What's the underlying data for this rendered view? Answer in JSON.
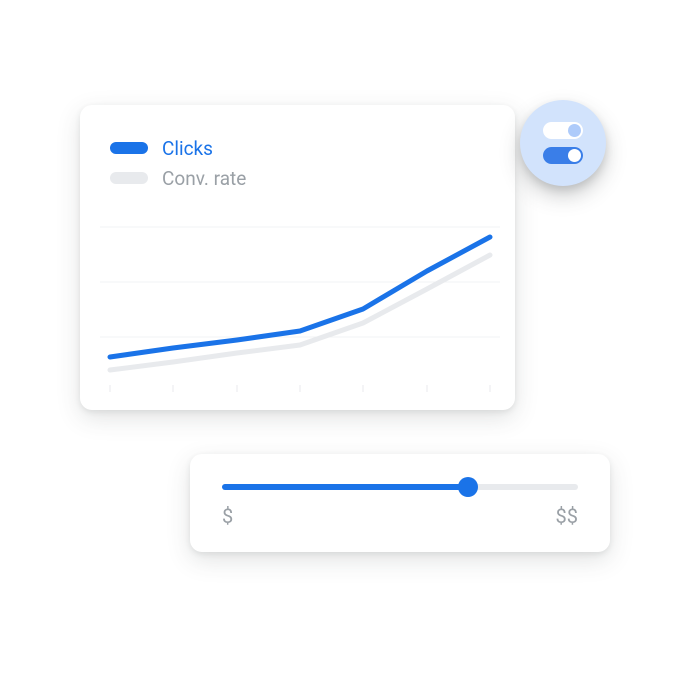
{
  "chart_data": {
    "type": "line",
    "x": [
      0,
      1,
      2,
      3,
      4,
      5,
      6
    ],
    "series": [
      {
        "name": "Clicks",
        "color": "#1a73e8",
        "values": [
          20,
          25,
          30,
          35,
          48,
          70,
          90
        ]
      },
      {
        "name": "Conv. rate",
        "color": "#e8eaed",
        "values": [
          12,
          17,
          22,
          27,
          40,
          60,
          80
        ]
      }
    ],
    "xlabel": "",
    "ylabel": "",
    "ylim": [
      0,
      100
    ],
    "gridlines": 3
  },
  "legend": {
    "clicks": "Clicks",
    "conv_rate": "Conv. rate"
  },
  "toggles": {
    "top_state": "off",
    "bottom_state": "on"
  },
  "slider": {
    "min_label": "$",
    "max_label": "$$",
    "value_pct": 69
  },
  "colors": {
    "primary": "#1a73e8",
    "light_blue": "#d2e3fc",
    "grey": "#e8eaed",
    "text_grey": "#9aa0a6"
  }
}
